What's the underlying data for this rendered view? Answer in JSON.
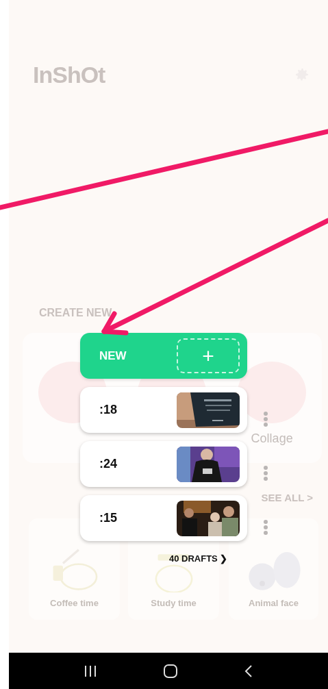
{
  "header": {
    "logo": "InShOt"
  },
  "create_new": {
    "title": "CREATE NEW",
    "visible_label": "Collage"
  },
  "materials": {
    "see_all": "SEE ALL >",
    "items": [
      {
        "label": "Coffee time",
        "kind": "coffee"
      },
      {
        "label": "Study time",
        "kind": "study"
      },
      {
        "label": "Animal face",
        "kind": "animal"
      }
    ]
  },
  "new_button": {
    "label": "NEW",
    "icon": "+"
  },
  "drafts": [
    {
      "duration": ":18",
      "kind": "picture"
    },
    {
      "duration": ":24",
      "kind": "picture"
    },
    {
      "duration": ":15",
      "kind": "picture"
    }
  ],
  "drafts_link": "40 DRAFTS ❯"
}
